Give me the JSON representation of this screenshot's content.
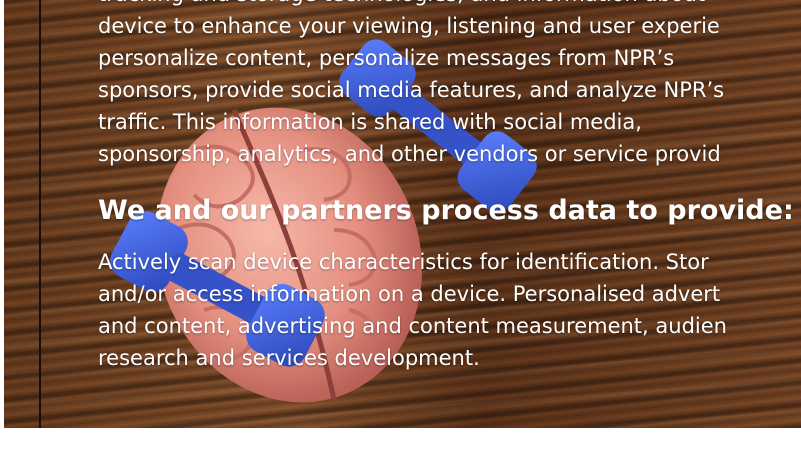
{
  "consent": {
    "intro_lines": [
      "tracking and storage technologies, and information about",
      "device to enhance your viewing, listening and user experie",
      "personalize content, personalize messages from NPR’s",
      "sponsors, provide social media features, and analyze NPR’s",
      "traffic. This information is shared with social media,",
      "sponsorship, analytics, and other vendors or service provid"
    ],
    "heading": "We and our partners process data to provide:",
    "purposes_lines": [
      "Actively scan device characteristics for identification. Stor",
      "and/or access information on a device. Personalised advert",
      "and content, advertising and content measurement, audien",
      "research and services development."
    ]
  },
  "background": {
    "image_subject": "brain model with blue dumbbells on wooden table",
    "colors": {
      "wood": "#6b3d1f",
      "brain": "#e8998a",
      "dumbbell": "#3b5fd9",
      "text": "#ffffff"
    }
  }
}
